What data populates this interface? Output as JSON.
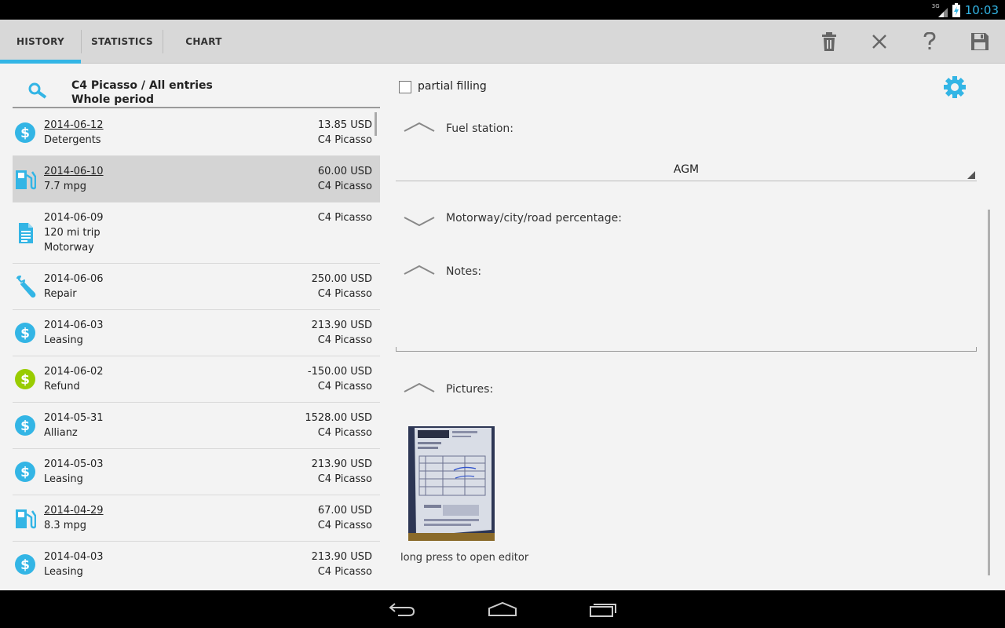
{
  "status": {
    "time": "10:03",
    "network": "3G"
  },
  "tabs": [
    {
      "label": "HISTORY",
      "active": true
    },
    {
      "label": "STATISTICS",
      "active": false
    },
    {
      "label": "CHART",
      "active": false
    }
  ],
  "actions": [
    "trash-icon",
    "close-icon",
    "help-icon",
    "save-icon"
  ],
  "filter": {
    "title": "C4 Picasso / All entries",
    "period": "Whole period"
  },
  "entries": [
    {
      "icon": "dollar-icon",
      "date": "2014-06-12",
      "desc": "Detergents",
      "amount": "13.85 USD",
      "car": "C4 Picasso"
    },
    {
      "icon": "fuel-pump-icon",
      "date": "2014-06-10",
      "desc": "7.7 mpg",
      "amount": "60.00 USD",
      "car": "C4 Picasso"
    },
    {
      "icon": "document-icon",
      "date": "2014-06-09",
      "desc": "120 mi trip",
      "desc2": "Motorway",
      "amount": "",
      "car": "C4 Picasso"
    },
    {
      "icon": "wrench-icon",
      "date": "2014-06-06",
      "desc": "Repair",
      "amount": "250.00 USD",
      "car": "C4 Picasso"
    },
    {
      "icon": "dollar-icon",
      "date": "2014-06-03",
      "desc": "Leasing",
      "amount": "213.90 USD",
      "car": "C4 Picasso"
    },
    {
      "icon": "refund-dollar-icon",
      "date": "2014-06-02",
      "desc": "Refund",
      "amount": "-150.00 USD",
      "car": "C4 Picasso"
    },
    {
      "icon": "dollar-icon",
      "date": "2014-05-31",
      "desc": "Allianz",
      "amount": "1528.00 USD",
      "car": "C4 Picasso"
    },
    {
      "icon": "dollar-icon",
      "date": "2014-05-03",
      "desc": "Leasing",
      "amount": "213.90 USD",
      "car": "C4 Picasso"
    },
    {
      "icon": "fuel-pump-icon",
      "date": "2014-04-29",
      "desc": "8.3 mpg",
      "amount": "67.00 USD",
      "car": "C4 Picasso"
    },
    {
      "icon": "dollar-icon",
      "date": "2014-04-03",
      "desc": "Leasing",
      "amount": "213.90 USD",
      "car": "C4 Picasso"
    }
  ],
  "detail": {
    "partial_label": "partial filling",
    "partial_checked": false,
    "fuel_station_label": "Fuel station:",
    "fuel_station_value": "AGM",
    "percentage_label": "Motorway/city/road percentage:",
    "notes_label": "Notes:",
    "pictures_label": "Pictures:",
    "picture_hint": "long press to open editor",
    "receipt": {
      "brand": "AGM",
      "rows": [
        "BENZINA 95",
        "SUPER PLUS",
        "DIESEL",
        "MOTOROL"
      ]
    }
  },
  "colors": {
    "accent": "#33b5e5",
    "refund": "#99cc00",
    "selected": "#d4d4d4"
  }
}
